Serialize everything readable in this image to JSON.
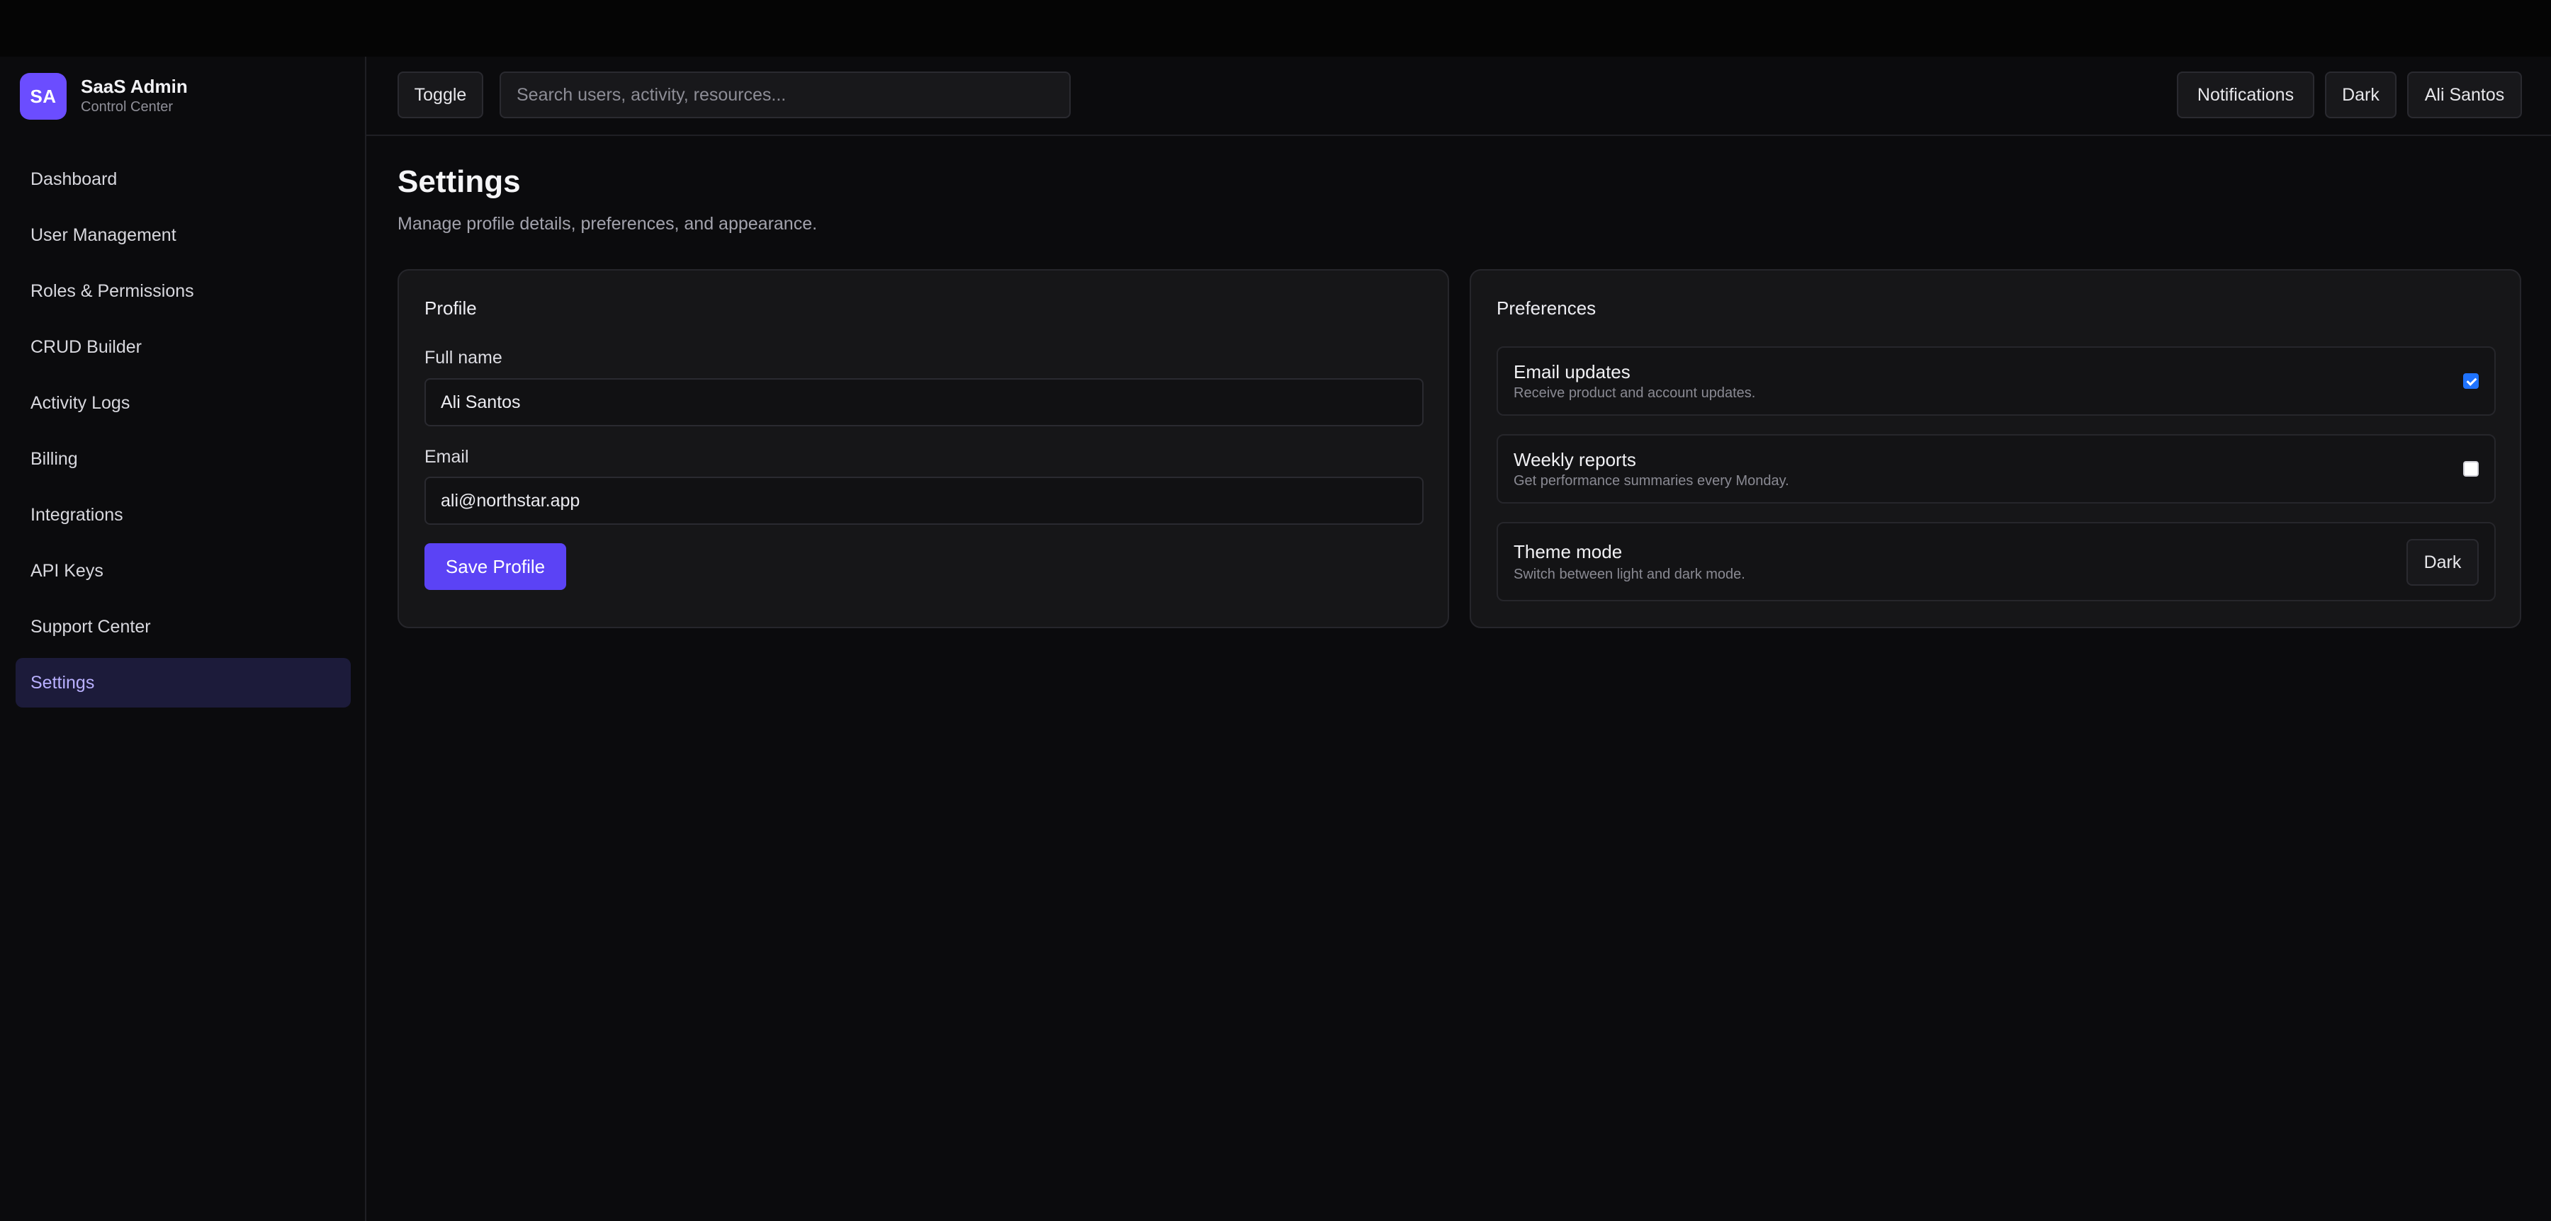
{
  "sidebar": {
    "brand": {
      "initials": "SA",
      "title": "SaaS Admin",
      "subtitle": "Control Center"
    },
    "items": [
      {
        "label": "Dashboard"
      },
      {
        "label": "User Management"
      },
      {
        "label": "Roles & Permissions"
      },
      {
        "label": "CRUD Builder"
      },
      {
        "label": "Activity Logs"
      },
      {
        "label": "Billing"
      },
      {
        "label": "Integrations"
      },
      {
        "label": "API Keys"
      },
      {
        "label": "Support Center"
      },
      {
        "label": "Settings"
      }
    ],
    "active_item": "Settings"
  },
  "header": {
    "toggle_label": "Toggle",
    "search_placeholder": "Search users, activity, resources...",
    "notifications_label": "Notifications",
    "theme_label": "Dark",
    "user_label": "Ali Santos"
  },
  "page": {
    "title": "Settings",
    "subtitle": "Manage profile details, preferences, and appearance."
  },
  "profile": {
    "title": "Profile",
    "full_name_label": "Full name",
    "full_name_value": "Ali Santos",
    "email_label": "Email",
    "email_value": "ali@northstar.app",
    "save_label": "Save Profile"
  },
  "preferences": {
    "title": "Preferences",
    "email_updates": {
      "title": "Email updates",
      "description": "Receive product and account updates.",
      "checked": true
    },
    "weekly_reports": {
      "title": "Weekly reports",
      "description": "Get performance summaries every Monday.",
      "checked": false
    },
    "theme_mode": {
      "title": "Theme mode",
      "description": "Switch between light and dark mode.",
      "button_label": "Dark"
    }
  },
  "colors": {
    "accent": "#5b43f5",
    "brand": "#6b4dff",
    "active_nav_bg": "#1c1b3a",
    "checkbox_checked": "#1f73ff"
  }
}
